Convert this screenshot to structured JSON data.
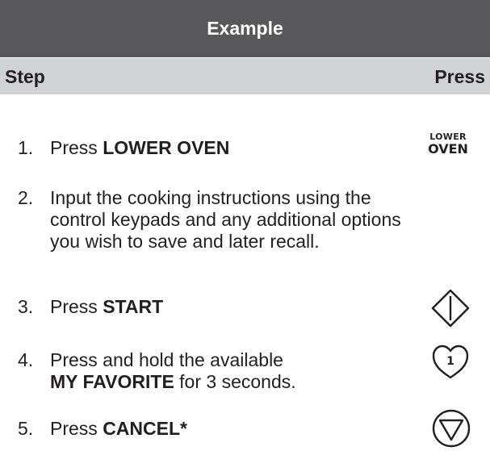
{
  "header": {
    "title": "Example"
  },
  "columns": {
    "step": "Step",
    "press": "Press"
  },
  "steps": [
    {
      "number": "1.",
      "lines": [
        {
          "prefix": "Press ",
          "bold": "LOWER OVEN",
          "suffix": ""
        }
      ],
      "press_icon": "lower-oven-button",
      "press_icon_text": [
        "LOWER",
        "OVEN"
      ]
    },
    {
      "number": "2.",
      "lines": [
        {
          "prefix": "Input the cooking instructions using the",
          "bold": "",
          "suffix": ""
        },
        {
          "prefix": "control keypads and any additional options",
          "bold": "",
          "suffix": ""
        },
        {
          "prefix": "you wish to save and later recall.",
          "bold": "",
          "suffix": ""
        }
      ],
      "press_icon": ""
    },
    {
      "number": "3.",
      "lines": [
        {
          "prefix": "Press ",
          "bold": "START",
          "suffix": ""
        }
      ],
      "press_icon": "start-icon"
    },
    {
      "number": "4.",
      "lines": [
        {
          "prefix": "Press and hold the available",
          "bold": "",
          "suffix": ""
        },
        {
          "prefix": "",
          "bold": "MY FAVORITE",
          "suffix": " for 3 seconds."
        }
      ],
      "press_icon": "favorite-heart-icon",
      "press_icon_text": "1"
    },
    {
      "number": "5.",
      "lines": [
        {
          "prefix": "Press ",
          "bold": "CANCEL*",
          "suffix": ""
        }
      ],
      "press_icon": "cancel-icon"
    }
  ],
  "colors": {
    "header_bg": "#58585a",
    "subheader_bg": "#d1d2d4",
    "text": "#231f20"
  }
}
